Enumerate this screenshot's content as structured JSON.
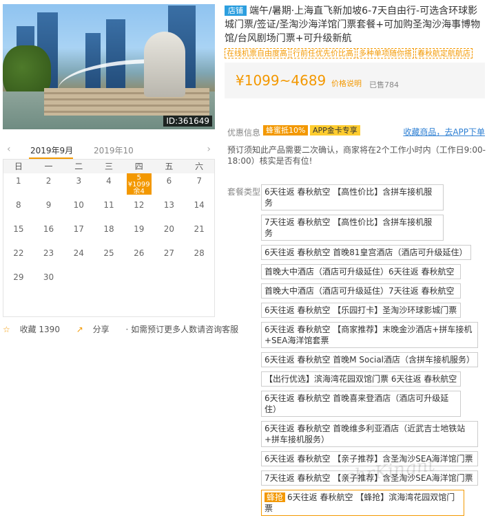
{
  "hero": {
    "image_id": "ID:361649"
  },
  "calendar": {
    "prev_icon": "chevron-left-icon",
    "next_icon": "chevron-right-icon",
    "month_active": "2019年9月",
    "month_next": "2019年10",
    "weekdays": [
      "日",
      "一",
      "二",
      "三",
      "四",
      "五",
      "六"
    ],
    "days": [
      "1",
      "2",
      "3",
      "4",
      "5",
      "6",
      "7",
      "8",
      "9",
      "10",
      "11",
      "12",
      "13",
      "14",
      "15",
      "16",
      "17",
      "18",
      "19",
      "20",
      "21",
      "22",
      "23",
      "24",
      "25",
      "26",
      "27",
      "28",
      "29",
      "30"
    ],
    "selected_day": "5",
    "selected_price": "¥1099",
    "selected_stock": "余4"
  },
  "left_footer": {
    "favorite": "收藏 1390",
    "share": "分享",
    "consult": "· 如需预订更多人数请咨询客服"
  },
  "product": {
    "shop_badge": "店铺",
    "title": "端午/暑期·上海直飞新加坡6-7天自由行-可选含环球影城门票/签证/圣淘沙海洋馆门票套餐+可加购圣淘沙海事博物馆/台风剧场门票+可升级新航",
    "tags": [
      "在线机票自由度高",
      "行前任优先价比高",
      "多种单项随你搭",
      "春秋航定航航店"
    ],
    "price": "¥1099~4689",
    "price_explain": "价格说明",
    "sold": "已售784"
  },
  "promo": {
    "label": "优惠信息",
    "badge1": "蜂蜜抵10%",
    "badge2": "APP金卡专享",
    "fav_app": "收藏商品，去APP下单"
  },
  "notice": "预订须知此产品需要二次确认，商家将在2个工作小时内（工作日9:00-18:00）核实是否有位!",
  "packages": {
    "label": "套餐类型",
    "items": [
      "6天往返 春秋航空 【高性价比】含拼车接机服务",
      "7天往返 春秋航空 【高性价比】含拼车接机服务",
      "6天往返 春秋航空 首晚81皇宫酒店（酒店可升级延住）",
      "首晚大中酒店（酒店可升级延住）6天往返 春秋航空",
      "首晚大中酒店（酒店可升级延住）7天往返 春秋航空",
      "6天往返 春秋航空 【乐园打卡】圣淘沙环球影城门票",
      "6天往返 春秋航空 【商家推荐】末晚金沙酒店+拼车接机+SEA海洋馆套票",
      "6天往返 春秋航空 首晚M Social酒店（含拼车接机服务）",
      "【出行优选】滨海湾花园双馆门票 6天往返 春秋航空",
      "6天往返 春秋航空 首晚喜来登酒店（酒店可升级延住）",
      "6天往返 春秋航空 首晚维多利亚酒店（近武吉士地铁站+拼车接机服务）",
      "6天往返 春秋航空 【亲子推荐】含圣淘沙SEA海洋馆门票",
      "7天往返 春秋航空 【亲子推荐】含圣淘沙SEA海洋馆门票"
    ],
    "last_snap": "蜂抢",
    "last_item": "6天往返 春秋航空 【蜂抢】滨海湾花园双馆门票"
  },
  "watermark": "chrKingnt"
}
